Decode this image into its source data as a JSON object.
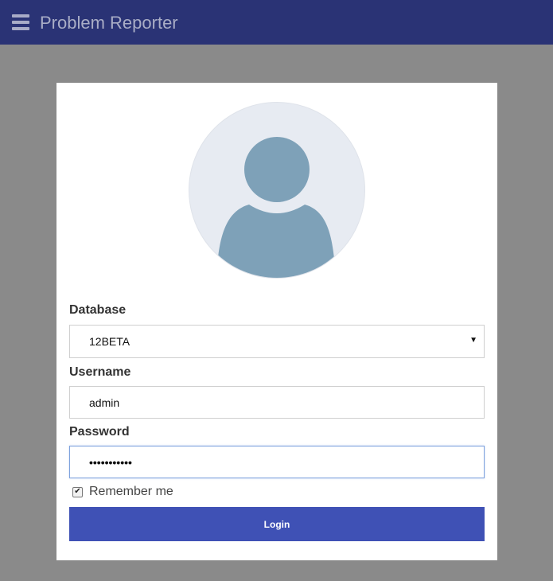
{
  "header": {
    "menu_icon": "hamburger-menu-icon",
    "title": "Problem Reporter"
  },
  "login_form": {
    "avatar_icon": "user-avatar-icon",
    "database": {
      "label": "Database",
      "value": "12BETA",
      "dropdown_icon": "caret-down-icon"
    },
    "username": {
      "label": "Username",
      "value": "admin"
    },
    "password": {
      "label": "Password",
      "value": "•••••••••••"
    },
    "remember": {
      "label": "Remember me",
      "checked": true
    },
    "login_button": "Login"
  },
  "colors": {
    "header_bg": "#2a3375",
    "page_bg": "#8a8a8a",
    "button_bg": "#3f51b5",
    "avatar_bg": "#e7ebf2",
    "avatar_figure": "#7ea1b8"
  }
}
